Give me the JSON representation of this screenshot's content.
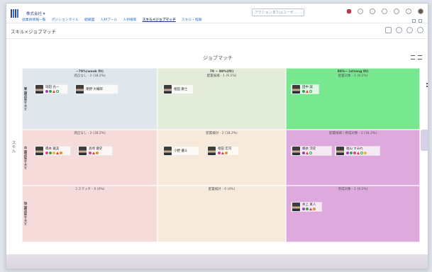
{
  "app": {
    "org_name": "株式会社 ▾",
    "search_placeholder": "アクションまたはユーザ…"
  },
  "nav": {
    "tabs": [
      {
        "label": "従業員情報一覧",
        "active": false
      },
      {
        "label": "ポジションタイル",
        "active": false
      },
      {
        "label": "組織図",
        "active": false
      },
      {
        "label": "人材プール",
        "active": false
      },
      {
        "label": "人材検索",
        "active": false
      },
      {
        "label": "スキル×ジョブマッチ",
        "active": true
      },
      {
        "label": "スキル・経験",
        "active": false
      }
    ]
  },
  "page": {
    "title": "スキル×ジョブマッチ",
    "matrix_title": "ジョブマッチ",
    "y_axis_label": "スキル"
  },
  "matrix": {
    "rows": [
      {
        "label": "スキル充足度 高",
        "cells": [
          {
            "color": "#dfe7ec",
            "header_bold": "~79%(weak fit)",
            "header": "適正なし - 2 (18.2%)",
            "candidates": [
              {
                "name": "瑞田 光一",
                "badges": [
                  "purple",
                  "green",
                  "red",
                  "ring"
                ]
              },
              {
                "name": "東野 大輔郎",
                "badges": []
              }
            ]
          },
          {
            "color": "#e2ecd9",
            "header_bold": "79 ~ 88%(fit)",
            "header": "配置候補 - 1 (9.1%)",
            "candidates": [
              {
                "name": "相田 康士",
                "badges": []
              }
            ]
          },
          {
            "color": "#77e88f",
            "header_bold": "89%~ (strong fit)",
            "header": "配置対象 - 1 (9.1%)",
            "candidates": [
              {
                "name": "田中 誠",
                "badges": [
                  "green",
                  "red",
                  "ring"
                ]
              }
            ]
          }
        ]
      },
      {
        "label": "スキル充足度 中",
        "cells": [
          {
            "color": "#f6dbdb",
            "header_bold": "",
            "header": "適正なし - 2 (18.2%)",
            "candidates": [
              {
                "name": "橋本 雅美",
                "badges": [
                  "heart",
                  "green",
                  "yellow",
                  "red",
                  "orange"
                ]
              },
              {
                "name": "高崎 健史",
                "badges": [
                  "heart",
                  "red",
                  "orange"
                ]
              }
            ]
          },
          {
            "color": "#f7eadb",
            "header_bold": "",
            "header": "配置検討 - 2 (18.2%)",
            "candidates": [
              {
                "name": "小野 優斗",
                "badges": []
              },
              {
                "name": "相田 宏司",
                "badges": [
                  "heart",
                  "red",
                  "orange"
                ]
              }
            ]
          },
          {
            "color": "#deaade",
            "header_bold": "",
            "header": "配置候補 / 育成対象 - 2 (18.2%)",
            "candidates": [
              {
                "name": "橘本 涼史",
                "badges": [
                  "purple",
                  "red",
                  "ring"
                ]
              },
              {
                "name": "福山 すみれ",
                "badges": [
                  "purple",
                  "green",
                  "heart",
                  "red",
                  "ring",
                  "yellow"
                ]
              }
            ]
          }
        ]
      },
      {
        "label": "スキル充足度 低",
        "cells": [
          {
            "color": "#f6dbdb",
            "header_bold": "",
            "header": "ミスマッチ - 0 (0%)",
            "candidates": []
          },
          {
            "color": "#f7eadb",
            "header_bold": "",
            "header": "配置検討 - 0 (0%)",
            "candidates": []
          },
          {
            "color": "#deaade",
            "header_bold": "",
            "header": "育成対象 - 1 (9.1%)",
            "candidates": [
              {
                "name": "井上 真人",
                "badges": [
                  "purple",
                  "green",
                  "red",
                  "orange"
                ]
              }
            ]
          }
        ]
      }
    ]
  }
}
